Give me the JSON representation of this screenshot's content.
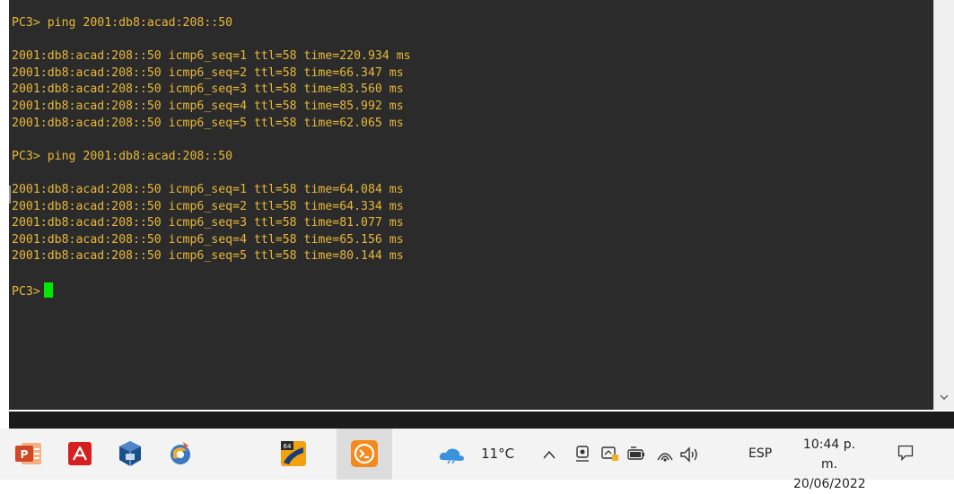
{
  "terminal": {
    "lines": [
      "PC3> ping 2001:db8:acad:208::50",
      "",
      "2001:db8:acad:208::50 icmp6_seq=1 ttl=58 time=220.934 ms",
      "2001:db8:acad:208::50 icmp6_seq=2 ttl=58 time=66.347 ms",
      "2001:db8:acad:208::50 icmp6_seq=3 ttl=58 time=83.560 ms",
      "2001:db8:acad:208::50 icmp6_seq=4 ttl=58 time=85.992 ms",
      "2001:db8:acad:208::50 icmp6_seq=5 ttl=58 time=62.065 ms",
      "",
      "PC3> ping 2001:db8:acad:208::50",
      "",
      "2001:db8:acad:208::50 icmp6_seq=1 ttl=58 time=64.084 ms",
      "2001:db8:acad:208::50 icmp6_seq=2 ttl=58 time=64.334 ms",
      "2001:db8:acad:208::50 icmp6_seq=3 ttl=58 time=81.077 ms",
      "2001:db8:acad:208::50 icmp6_seq=4 ttl=58 time=65.156 ms",
      "2001:db8:acad:208::50 icmp6_seq=5 ttl=58 time=80.144 ms",
      ""
    ],
    "prompt": "PC3>",
    "text_color": "#e8b83a",
    "background_color": "#2b2b2b",
    "cursor_color": "#00e800"
  },
  "scrollbar": {
    "down_arrow": "chevron-down-icon"
  },
  "taskbar": {
    "apps": [
      {
        "name": "powerpoint-icon",
        "color": "#d24726"
      },
      {
        "name": "acrobat-reader-icon",
        "color": "#d4201f"
      },
      {
        "name": "virtualbox-icon",
        "color": "#1b4f8a"
      },
      {
        "name": "web-browser-icon",
        "color": "#3a78c2"
      },
      {
        "name": "packet-tracer-icon",
        "color": "#f2a10f"
      },
      {
        "name": "terminal-app-icon",
        "color": "#f28a1d"
      }
    ],
    "tray": {
      "temperature": "11°C",
      "language": "ESP",
      "time": "10:44 p. m.",
      "date": "20/06/2022",
      "icons": [
        "weather-cloud-icon",
        "chevron-up-icon",
        "meet-now-icon",
        "onedrive-icon",
        "battery-icon",
        "wifi-icon",
        "volume-icon"
      ]
    }
  }
}
